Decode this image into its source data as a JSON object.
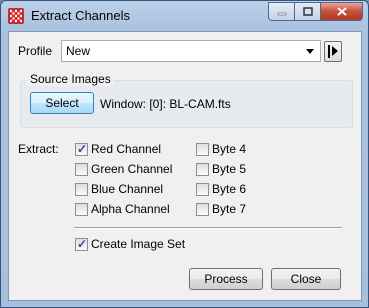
{
  "window": {
    "title": "Extract Channels"
  },
  "profile": {
    "label": "Profile",
    "value": "New"
  },
  "source": {
    "group_title": "Source Images",
    "select_label": "Select",
    "window_text": "Window: [0]: BL-CAM.fts"
  },
  "extract": {
    "label": "Extract:",
    "channels": [
      {
        "label": "Red Channel",
        "checked": true
      },
      {
        "label": "Green Channel",
        "checked": false
      },
      {
        "label": "Blue Channel",
        "checked": false
      },
      {
        "label": "Alpha Channel",
        "checked": false
      }
    ],
    "bytes": [
      {
        "label": "Byte 4",
        "checked": false
      },
      {
        "label": "Byte 5",
        "checked": false
      },
      {
        "label": "Byte 6",
        "checked": false
      },
      {
        "label": "Byte 7",
        "checked": false
      }
    ]
  },
  "create_set": {
    "label": "Create Image Set",
    "checked": true
  },
  "buttons": {
    "process": "Process",
    "close": "Close"
  },
  "colors": {
    "title_bg": "#bcd0e8",
    "close_btn": "#c5503a",
    "check": "#264c9a"
  }
}
